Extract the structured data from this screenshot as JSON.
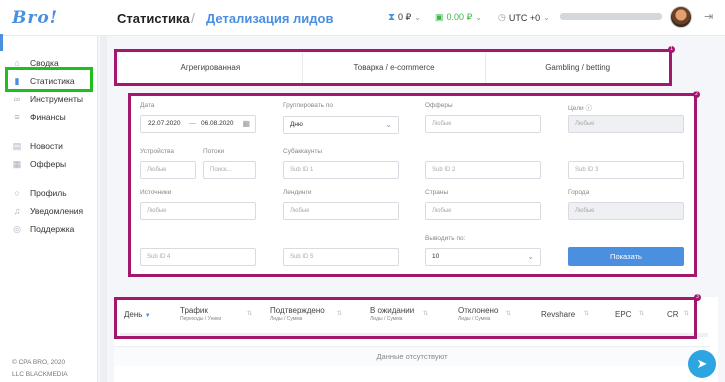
{
  "header": {
    "logo": "Bro!",
    "title": "Статистика",
    "separator": "/",
    "subtitle": "Детализация лидов",
    "balance1": "0 ₽",
    "balance2": "0.00 ₽",
    "timezone": "UTC +0"
  },
  "sidebar": {
    "items": [
      {
        "label": "Сводка",
        "icon": "home-icon"
      },
      {
        "label": "Статистика",
        "icon": "chart-icon"
      },
      {
        "label": "Инструменты",
        "icon": "link-icon"
      },
      {
        "label": "Финансы",
        "icon": "database-icon"
      },
      {
        "label": "Новости",
        "icon": "news-icon"
      },
      {
        "label": "Офферы",
        "icon": "list-icon"
      },
      {
        "label": "Профиль",
        "icon": "user-icon"
      },
      {
        "label": "Уведомления",
        "icon": "bell-icon"
      },
      {
        "label": "Поддержка",
        "icon": "globe-icon"
      }
    ],
    "footer1": "© CPA BRO, 2020",
    "footer2": "LLC BLACKMEDIA"
  },
  "tabs": [
    "Агрегированная",
    "Товарка / e-commerce",
    "Gambling / betting"
  ],
  "badges": [
    "1",
    "2",
    "3"
  ],
  "filters": {
    "date_label": "Дата",
    "date_from": "22.07.2020",
    "date_sep": "—",
    "date_to": "06.08.2020",
    "group_label": "Группировать по",
    "group_value": "Дню",
    "offers_label": "Офферы",
    "offers_ph": "Любые",
    "goals_label": "Цели",
    "goals_ph": "Любые",
    "devices_label": "Устройства",
    "devices_ph": "Любые",
    "streams_label": "Потоки",
    "streams_ph": "Поиск...",
    "subacc_label": "Субаккаунты",
    "sub1": "Sub ID 1",
    "sub2": "Sub ID 2",
    "sub3": "Sub ID 3",
    "sources_label": "Источники",
    "sources_ph": "Любые",
    "landings_label": "Лендинги",
    "landings_ph": "Любые",
    "countries_label": "Страны",
    "countries_ph": "Любые",
    "cities_label": "Города",
    "cities_ph": "Любые",
    "sub4": "Sub ID 4",
    "sub5": "Sub ID 5",
    "output_label": "Выводить по:",
    "output_value": "10",
    "show_button": "Показать"
  },
  "table": {
    "columns": [
      {
        "label": "День",
        "sub": ""
      },
      {
        "label": "Трафик",
        "sub": "Переходы / Уники"
      },
      {
        "label": "Подтверждено",
        "sub": "Лиды / Сумма"
      },
      {
        "label": "В ожидании",
        "sub": "Лиды / Сумма"
      },
      {
        "label": "Отклонено",
        "sub": "Лиды / Сумма"
      },
      {
        "label": "Revshare",
        "sub": ""
      },
      {
        "label": "EPC",
        "sub": ""
      },
      {
        "label": "CR",
        "sub": ""
      }
    ],
    "empty_text": "Данные отсутствуют"
  },
  "colors": {
    "accent": "#4a8fe0",
    "highlight": "#a3176d",
    "sidebar_highlight": "#1fbf1f",
    "telegram": "#2ca5e0"
  }
}
